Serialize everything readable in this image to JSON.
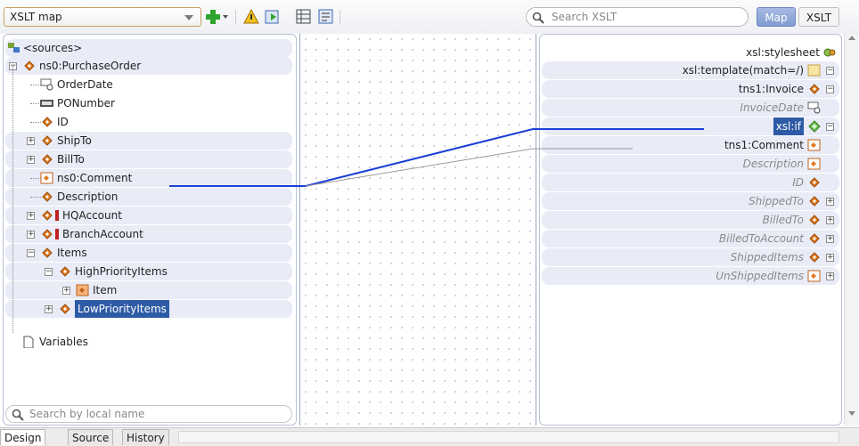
{
  "toolbar": {
    "map_select_value": "XSLT map",
    "search_placeholder": "Search XSLT",
    "map_button": "Map",
    "xslt_button": "XSLT"
  },
  "source_tree": {
    "root_label": "<sources>",
    "items": [
      {
        "label": "ns0:PurchaseOrder",
        "icon": "element-icon"
      },
      {
        "label": "OrderDate",
        "icon": "date-type-icon"
      },
      {
        "label": "PONumber",
        "icon": "xyz-type-icon"
      },
      {
        "label": "ID",
        "icon": "element-icon"
      },
      {
        "label": "ShipTo",
        "icon": "element-icon"
      },
      {
        "label": "BillTo",
        "icon": "element-icon"
      },
      {
        "label": "ns0:Comment",
        "icon": "attribute-icon"
      },
      {
        "label": "Description",
        "icon": "element-icon"
      },
      {
        "label": "HQAccount",
        "icon": "element-icon"
      },
      {
        "label": "BranchAccount",
        "icon": "element-icon"
      },
      {
        "label": "Items",
        "icon": "element-icon"
      },
      {
        "label": "HighPriorityItems",
        "icon": "element-icon"
      },
      {
        "label": "Item",
        "icon": "repeating-icon"
      },
      {
        "label": "LowPriorityItems",
        "icon": "element-icon"
      }
    ],
    "variables_label": "Variables",
    "search_placeholder": "Search by local name"
  },
  "target_tree": {
    "stylesheet_label": "xsl:stylesheet",
    "items": [
      {
        "label": "xsl:template(match=/)",
        "style": "normal"
      },
      {
        "label": "tns1:Invoice",
        "style": "normal"
      },
      {
        "label": "InvoiceDate",
        "style": "italic"
      },
      {
        "label": "xsl:if",
        "style": "selected"
      },
      {
        "label": "tns1:Comment",
        "style": "normal"
      },
      {
        "label": "Description",
        "style": "italic"
      },
      {
        "label": "ID",
        "style": "italic"
      },
      {
        "label": "ShippedTo",
        "style": "italic"
      },
      {
        "label": "BilledTo",
        "style": "italic"
      },
      {
        "label": "BilledToAccount",
        "style": "italic"
      },
      {
        "label": "ShippedItems",
        "style": "italic"
      },
      {
        "label": "UnShippedItems",
        "style": "italic"
      }
    ]
  },
  "bottom_tabs": [
    "Design",
    "Source",
    "History"
  ],
  "colors": {
    "link_line": "#1a3fd6",
    "element_icon": "#e07b20",
    "selection": "#2e5ba6"
  }
}
